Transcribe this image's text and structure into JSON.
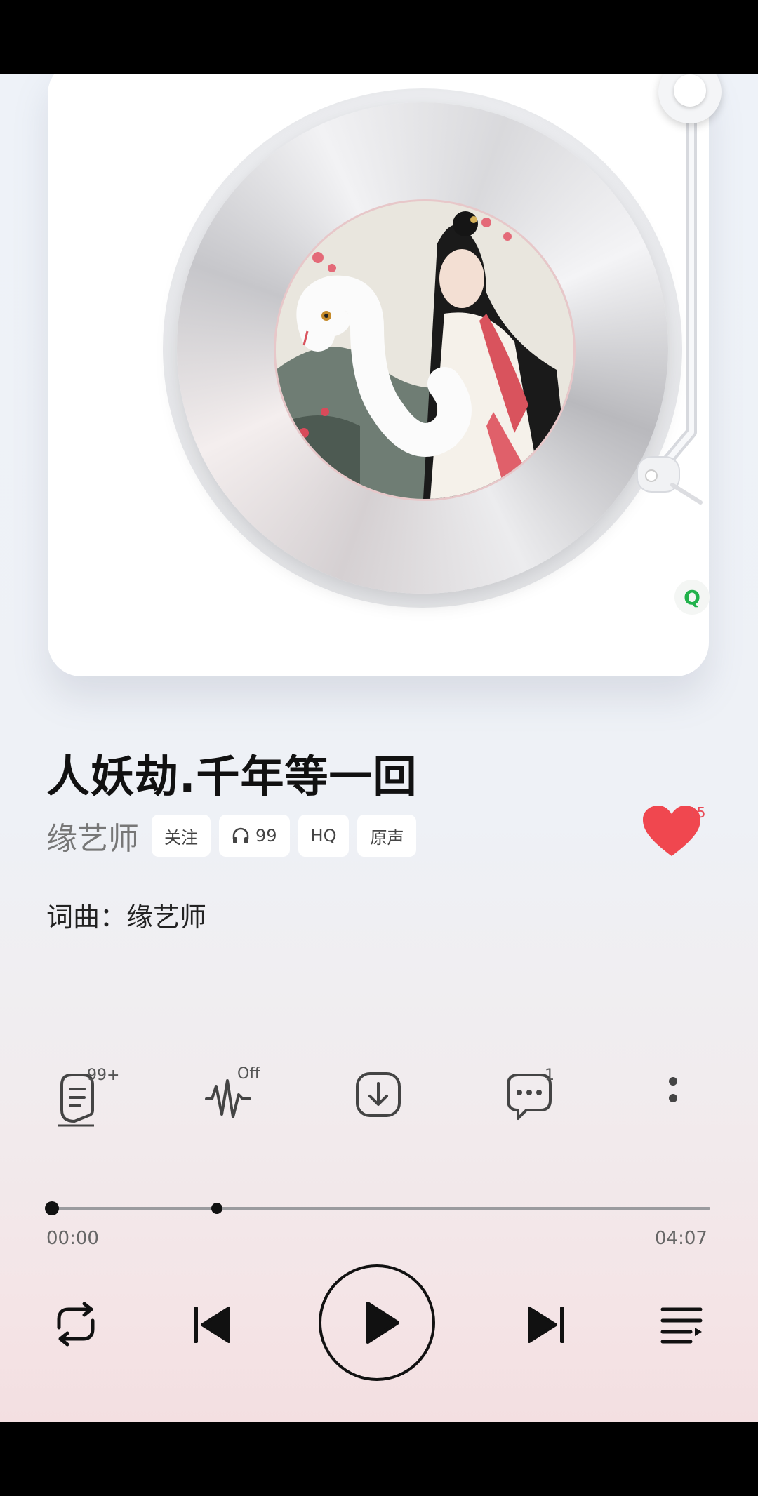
{
  "song": {
    "title": "人妖劫.千年等一回",
    "artist": "缘艺师",
    "follow_label": "关注",
    "listen_count": "99",
    "quality_label": "HQ",
    "version_label": "原声",
    "credits": "词曲：缘艺师",
    "like_count": "15",
    "liked": true
  },
  "source_badge": "Q",
  "actions": {
    "comments_badge": "99+",
    "effect_badge": "Off",
    "chat_badge": "1"
  },
  "player": {
    "current_time": "00:00",
    "total_time": "04:07",
    "progress": 0,
    "buffered": 0.25
  },
  "colors": {
    "like": "#f0474f",
    "text": "#111111",
    "accent_q": "#22b24c"
  },
  "icons": [
    "lyrics-icon",
    "sound-effect-icon",
    "download-icon",
    "comment-icon",
    "more-icon",
    "repeat-icon",
    "previous-icon",
    "play-icon",
    "next-icon",
    "playlist-icon",
    "heart-icon",
    "headphone-icon"
  ]
}
